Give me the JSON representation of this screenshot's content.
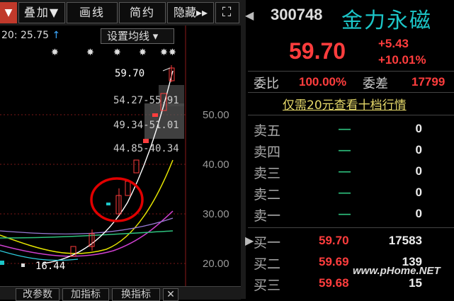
{
  "toolbar": {
    "overlay_label": "叠加▼",
    "draw_label": "画线",
    "simple_label": "简约",
    "hide_label": "隐藏▸▸",
    "fullscreen_glyph": "⛶",
    "red_arrow": "▼"
  },
  "chart": {
    "ma_text": "20: 25.75",
    "ma_arrow": "↑",
    "ma_settings_label": "设置均线 ▾",
    "price_labels": [
      "59.70",
      "54.27-55.91",
      "49.34-51.01",
      "44.85-40.34",
      "16.44"
    ],
    "y_ticks": [
      "50.00",
      "40.00",
      "30.00",
      "20.00"
    ]
  },
  "chart_data": {
    "type": "candlestick",
    "y_ticks": [
      50.0,
      40.0,
      30.0,
      20.0
    ],
    "annotations": [
      "59.70",
      "54.27-55.91",
      "49.34-51.01",
      "44.85-40.34",
      "16.44"
    ],
    "ma_20": 25.75
  },
  "bottom_bar": {
    "params_label": "改参数",
    "add_indicator_label": "加指标",
    "switch_indicator_label": "换指标",
    "close_glyph": "✕"
  },
  "quote": {
    "code": "300748",
    "name": "金力永磁",
    "price": "59.70",
    "change": "+5.43",
    "change_pct": "+10.01%",
    "weibi_label": "委比",
    "weibi_value": "100.00%",
    "weicha_label": "委差",
    "weicha_value": "17799",
    "promo_text": "仅需20元查看十档行情",
    "sell_rows": [
      {
        "label": "卖五",
        "price": "—",
        "volume": "0"
      },
      {
        "label": "卖四",
        "price": "—",
        "volume": "0"
      },
      {
        "label": "卖三",
        "price": "—",
        "volume": "0"
      },
      {
        "label": "卖二",
        "price": "—",
        "volume": "0"
      },
      {
        "label": "卖一",
        "price": "—",
        "volume": "0"
      }
    ],
    "buy_rows": [
      {
        "label": "买一",
        "price": "59.70",
        "volume": "17583"
      },
      {
        "label": "买二",
        "price": "59.69",
        "volume": "139"
      },
      {
        "label": "买三",
        "price": "59.68",
        "volume": "15"
      }
    ]
  },
  "watermark": "www.pHome.NET",
  "colors": {
    "up": "#ff3d3d",
    "down": "#2ec27e",
    "name": "#1cc6c8",
    "promo": "#e6d96a",
    "highlight_circle": "#e00000"
  }
}
